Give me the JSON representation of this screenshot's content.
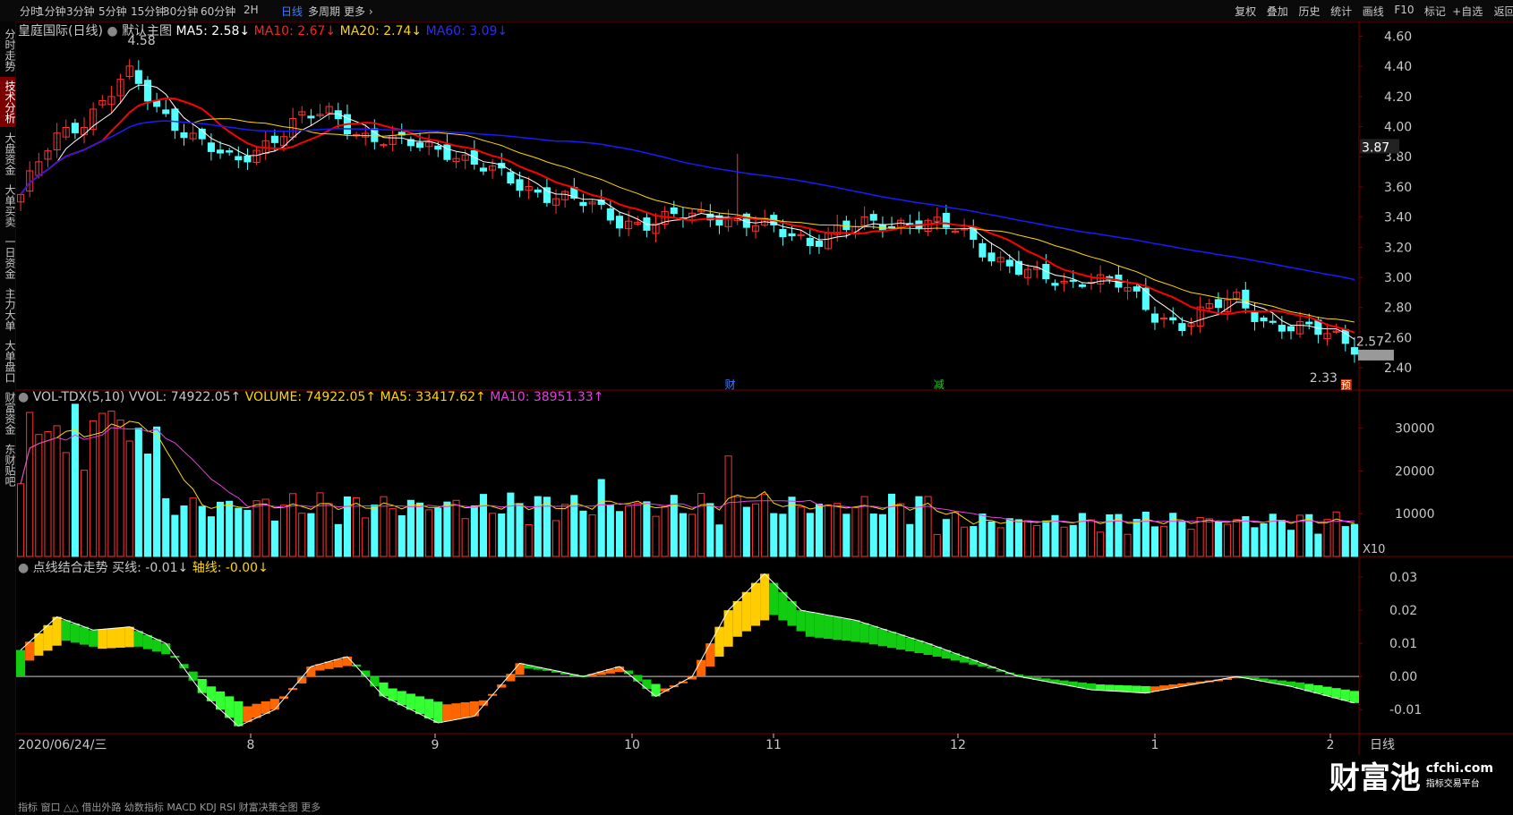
{
  "toolbar": {
    "left": [
      "分时",
      "1分钟",
      "3分钟",
      "5分钟",
      "15分钟",
      "30分钟",
      "60分钟",
      "2H",
      "日线",
      "多周期",
      "更多 ›"
    ],
    "active": "日线",
    "right": [
      "复权",
      "叠加",
      "历史",
      "统计",
      "画线",
      "F10",
      "标记",
      "+自选",
      "返回"
    ]
  },
  "sidebar": [
    "分时走势",
    "技术分析",
    "大盘资金",
    "大单买卖",
    "一日资金",
    "主力大单",
    "大单盘口",
    "财富资金",
    "东财贴吧"
  ],
  "sidebar_active": "技术分析",
  "main_header": {
    "name": "皇庭国际(日线)",
    "template": "默认主图",
    "ma5": "MA5: 2.58↓",
    "ma10": "MA10: 2.67↓",
    "ma20": "MA20: 2.74↓",
    "ma60": "MA60: 3.09↓"
  },
  "vol_header": {
    "name": "VOL-TDX(5,10)",
    "vvol": "VVOL: 74922.05↑",
    "volume": "VOLUME: 74922.05↑",
    "ma5": "MA5: 33417.62↑",
    "ma10": "MA10: 38951.33↑"
  },
  "ind_header": {
    "name": "点线结合走势",
    "buy": "买线: -0.01↓",
    "axis": "轴线: -0.00↓"
  },
  "price_axis": [
    "4.60",
    "4.40",
    "4.20",
    "4.00",
    "3.80",
    "3.60",
    "3.40",
    "3.20",
    "3.00",
    "2.80",
    "2.60",
    "2.40"
  ],
  "price_current": "3.87",
  "price_high_label": "4.58",
  "price_low_label": "2.33",
  "price_last_label": "2.57",
  "vol_axis": [
    "30000",
    "20000",
    "10000"
  ],
  "vol_unit": "X10",
  "ind_axis": [
    "0.03",
    "0.02",
    "0.01",
    "0.00",
    "-0.01"
  ],
  "date_axis": {
    "first": "2020/06/24/三",
    "months": [
      "8",
      "9",
      "10",
      "11",
      "12",
      "1",
      "2"
    ]
  },
  "markers": {
    "cai": "财",
    "jian": "减",
    "yu": "预"
  },
  "period_label": "日线",
  "bottom_text": "指标  窗口  △△ 借出外路  幼数指标  MACD  KDJ  RSI  财富决策全图  更多",
  "logo": {
    "main": "财富池",
    "site": "cfchi.com",
    "sub": "指标交易平台"
  },
  "colors": {
    "up": "#ff3232",
    "down": "#54ffff",
    "ma5": "#ffffff",
    "ma10": "#ff0000",
    "ma20": "#ffd700",
    "ma60": "#1a1aff"
  }
}
